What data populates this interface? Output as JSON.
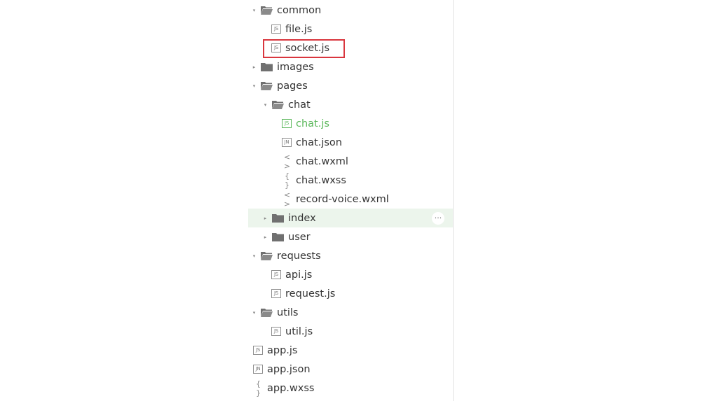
{
  "file_tree": {
    "items": [
      {
        "label": "common",
        "type": "folder",
        "expanded": true,
        "depth": 0
      },
      {
        "label": "file.js",
        "type": "js",
        "depth": 1
      },
      {
        "label": "socket.js",
        "type": "js",
        "depth": 1,
        "outlined": true
      },
      {
        "label": "images",
        "type": "folder",
        "expanded": false,
        "depth": 0
      },
      {
        "label": "pages",
        "type": "folder",
        "expanded": true,
        "depth": 0
      },
      {
        "label": "chat",
        "type": "folder",
        "expanded": true,
        "depth": 1
      },
      {
        "label": "chat.js",
        "type": "js",
        "depth": 2,
        "active": true
      },
      {
        "label": "chat.json",
        "type": "json",
        "depth": 2
      },
      {
        "label": "chat.wxml",
        "type": "wxml",
        "depth": 2
      },
      {
        "label": "chat.wxss",
        "type": "wxss",
        "depth": 2
      },
      {
        "label": "record-voice.wxml",
        "type": "wxml",
        "depth": 2
      },
      {
        "label": "index",
        "type": "folder",
        "expanded": false,
        "depth": 1,
        "hovered": true
      },
      {
        "label": "user",
        "type": "folder",
        "expanded": false,
        "depth": 1
      },
      {
        "label": "requests",
        "type": "folder",
        "expanded": true,
        "depth": 0
      },
      {
        "label": "api.js",
        "type": "js",
        "depth": 1
      },
      {
        "label": "request.js",
        "type": "js",
        "depth": 1
      },
      {
        "label": "utils",
        "type": "folder",
        "expanded": true,
        "depth": 0
      },
      {
        "label": "util.js",
        "type": "js",
        "depth": 1
      },
      {
        "label": "app.js",
        "type": "js",
        "depth": 0,
        "root_file": true
      },
      {
        "label": "app.json",
        "type": "json",
        "depth": 0,
        "root_file": true
      },
      {
        "label": "app.wxss",
        "type": "wxss",
        "depth": 0,
        "root_file": true
      }
    ],
    "icons": {
      "js": "JS",
      "json": "JN",
      "wxml": "< >",
      "wxss": "{ }",
      "expanded": "▾",
      "collapsed": "▸",
      "more": "···"
    },
    "colors": {
      "active_file": "#5cb85c",
      "hover_row": "#ecf5ec",
      "highlight_box": "#d9363e"
    }
  }
}
